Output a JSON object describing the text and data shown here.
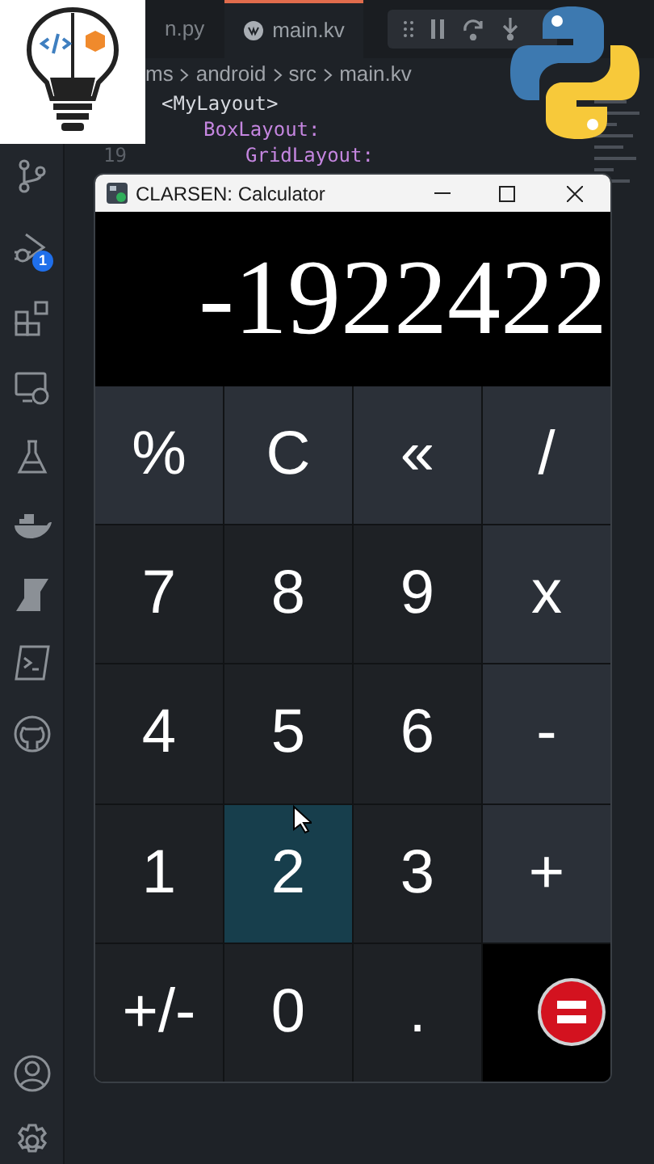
{
  "editor": {
    "tabs": [
      {
        "label": "n.py",
        "selected": false
      },
      {
        "label": "main.kv",
        "selected": true
      }
    ],
    "breadcrumb": [
      "ms",
      "android",
      "src",
      "main.kv"
    ],
    "lines": [
      {
        "text": "<MyLayout>",
        "kind": "tag",
        "children": [
          {
            "text": "BoxLayout:",
            "kind": "widget",
            "children": [
              {
                "number": "19",
                "text": "GridLayout:",
                "kind": "widget"
              }
            ]
          }
        ]
      }
    ]
  },
  "activity_bar": {
    "debug_badge": "1"
  },
  "calculator": {
    "title": "CLARSEN: Calculator",
    "display": "-1922422",
    "buttons": [
      {
        "label": "%",
        "kind": "operator",
        "selected": false
      },
      {
        "label": "C",
        "kind": "operator",
        "selected": false
      },
      {
        "label": "«",
        "kind": "operator",
        "selected": false
      },
      {
        "label": "/",
        "kind": "operator",
        "selected": false
      },
      {
        "label": "7",
        "kind": "digit",
        "selected": false
      },
      {
        "label": "8",
        "kind": "digit",
        "selected": false
      },
      {
        "label": "9",
        "kind": "digit",
        "selected": false
      },
      {
        "label": "x",
        "kind": "operator",
        "selected": false
      },
      {
        "label": "4",
        "kind": "digit",
        "selected": false
      },
      {
        "label": "5",
        "kind": "digit",
        "selected": false
      },
      {
        "label": "6",
        "kind": "digit",
        "selected": false
      },
      {
        "label": "-",
        "kind": "operator",
        "selected": false
      },
      {
        "label": "1",
        "kind": "digit",
        "selected": false
      },
      {
        "label": "2",
        "kind": "digit",
        "selected": true
      },
      {
        "label": "3",
        "kind": "digit",
        "selected": false
      },
      {
        "label": "+",
        "kind": "operator",
        "selected": false
      },
      {
        "label": "+/-",
        "kind": "digit",
        "selected": false
      },
      {
        "label": "0",
        "kind": "digit",
        "selected": false
      },
      {
        "label": ".",
        "kind": "digit",
        "selected": false
      },
      {
        "kind": "equals",
        "selected": false
      }
    ]
  }
}
